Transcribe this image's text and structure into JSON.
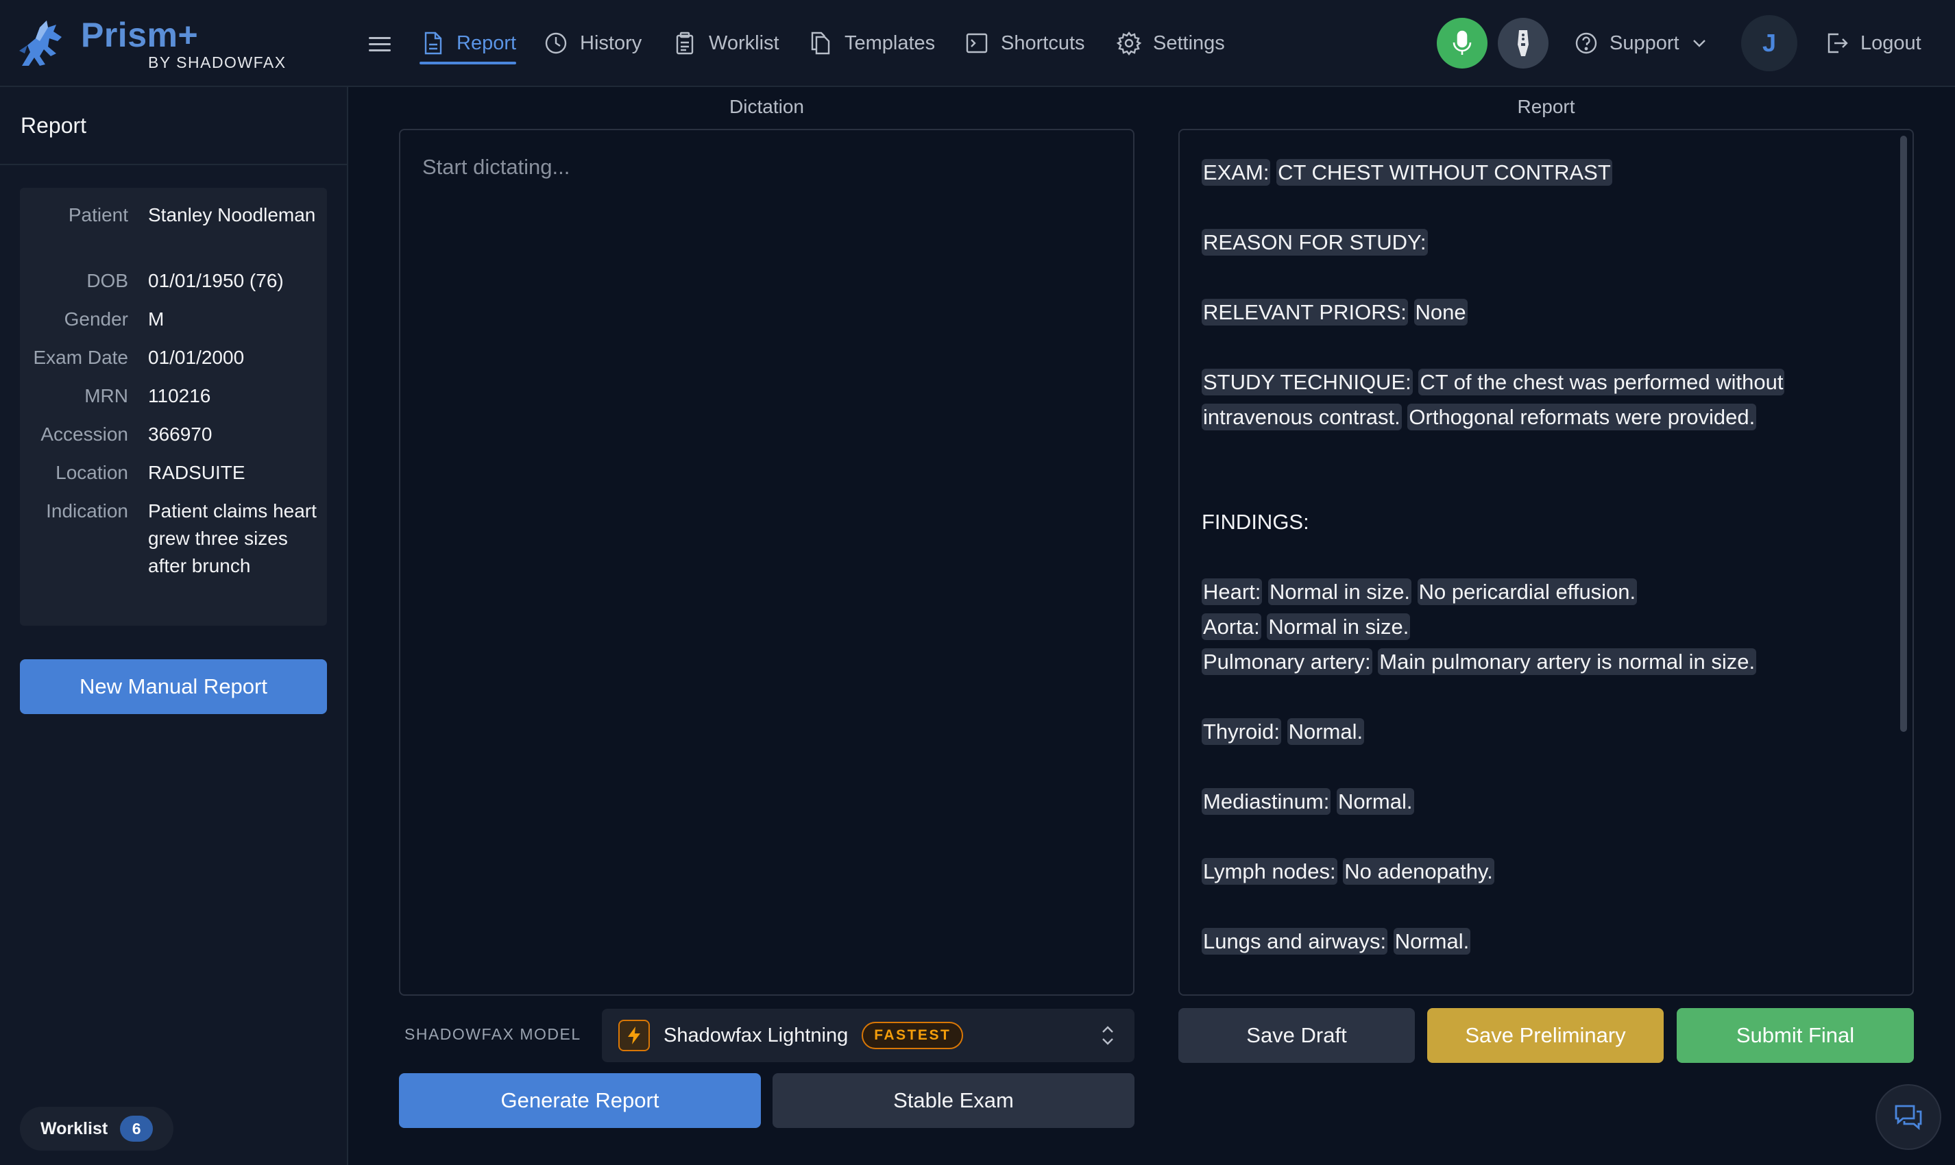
{
  "brand": {
    "name": "Prism+",
    "subtitle": "BY SHADOWFAX"
  },
  "nav": {
    "items": [
      {
        "label": "Report",
        "icon": "document-icon",
        "active": true
      },
      {
        "label": "History",
        "icon": "clock-icon"
      },
      {
        "label": "Worklist",
        "icon": "clipboard-icon"
      },
      {
        "label": "Templates",
        "icon": "copy-icon"
      },
      {
        "label": "Shortcuts",
        "icon": "terminal-icon"
      },
      {
        "label": "Settings",
        "icon": "gear-icon"
      }
    ],
    "support_label": "Support",
    "avatar_initial": "J",
    "logout_label": "Logout"
  },
  "sidebar": {
    "title": "Report",
    "patient": {
      "fields": [
        {
          "label": "Patient",
          "value": "Stanley Noodleman"
        },
        {
          "label": "DOB",
          "value": "01/01/1950 (76)"
        },
        {
          "label": "Gender",
          "value": "M"
        },
        {
          "label": "Exam Date",
          "value": "01/01/2000"
        },
        {
          "label": "MRN",
          "value": "110216"
        },
        {
          "label": "Accession",
          "value": "366970"
        },
        {
          "label": "Location",
          "value": "RADSUITE"
        },
        {
          "label": "Indication",
          "value": "Patient claims heart grew three sizes after brunch"
        }
      ]
    },
    "new_report_label": "New Manual Report",
    "worklist_label": "Worklist",
    "worklist_count": "6"
  },
  "dictation": {
    "title": "Dictation",
    "placeholder": "Start dictating...",
    "model_label": "SHADOWFAX MODEL",
    "model_name": "Shadowfax Lightning",
    "model_badge": "FASTEST",
    "generate_label": "Generate Report",
    "stable_label": "Stable Exam"
  },
  "report": {
    "title": "Report",
    "lines": {
      "exam_label": "EXAM:",
      "exam_value": "CT CHEST WITHOUT CONTRAST",
      "reason_label": "REASON FOR STUDY:",
      "priors_label": "RELEVANT PRIORS:",
      "priors_value": "None",
      "technique_label": "STUDY TECHNIQUE:",
      "technique_value_a": "CT of the chest was performed without",
      "technique_value_b": "intravenous contrast.",
      "technique_value_c": "Orthogonal reformats were provided.",
      "findings_label": "FINDINGS:",
      "heart_label": "Heart:",
      "heart_value_a": "Normal in size.",
      "heart_value_b": "No pericardial effusion.",
      "aorta_label": "Aorta:",
      "aorta_value": "Normal in size.",
      "pa_label": "Pulmonary artery:",
      "pa_value": "Main pulmonary artery is normal in size.",
      "thyroid_label": "Thyroid:",
      "thyroid_value": "Normal.",
      "mediastinum_label": "Mediastinum:",
      "mediastinum_value": "Normal.",
      "lymph_label": "Lymph nodes:",
      "lymph_value": "No adenopathy.",
      "lungs_label": "Lungs and airways:",
      "lungs_value": "Normal."
    },
    "save_draft_label": "Save Draft",
    "save_prelim_label": "Save Preliminary",
    "submit_final_label": "Submit Final"
  },
  "colors": {
    "accent": "#4680d6",
    "success": "#52b36a",
    "warning": "#c9a53b",
    "badge": "#d97706"
  }
}
